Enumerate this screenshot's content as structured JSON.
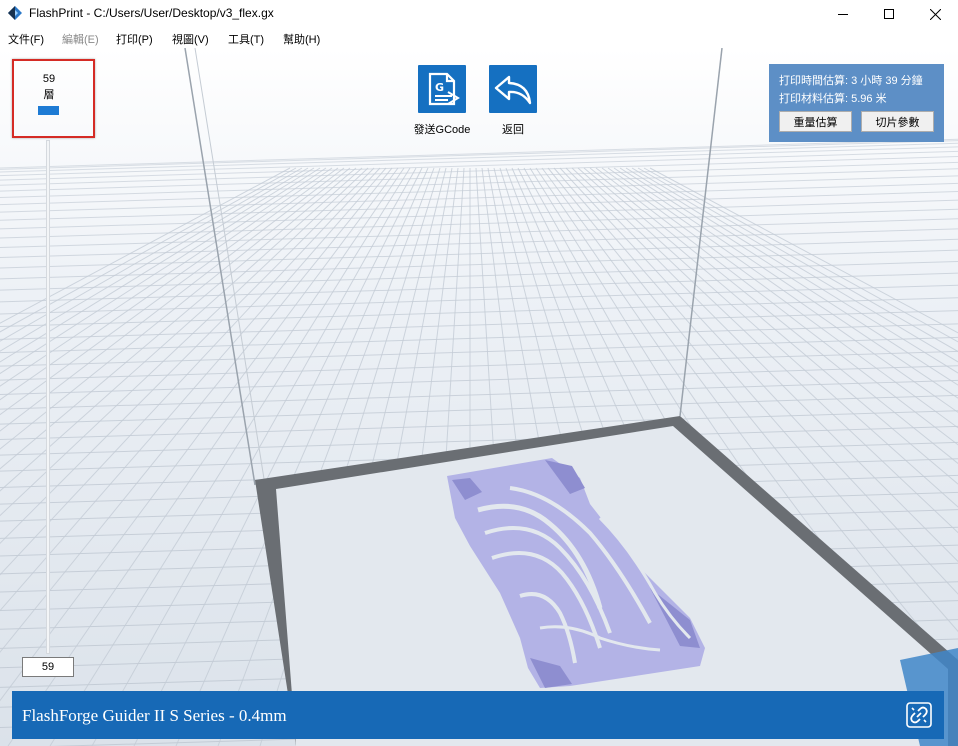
{
  "window": {
    "title": "FlashPrint - C:/Users/User/Desktop/v3_flex.gx"
  },
  "menu": [
    {
      "label": "文件(F)",
      "enabled": true
    },
    {
      "label": "編輯(E)",
      "enabled": false
    },
    {
      "label": "打印(P)",
      "enabled": true
    },
    {
      "label": "視圖(V)",
      "enabled": true
    },
    {
      "label": "工具(T)",
      "enabled": true
    },
    {
      "label": "幫助(H)",
      "enabled": true
    }
  ],
  "layer_panel": {
    "current_layer": "59",
    "unit": "層",
    "input_value": "59"
  },
  "toolbar": {
    "send_gcode_label": "發送GCode",
    "back_label": "返回"
  },
  "info_panel": {
    "print_time_label": "打印時間估算:",
    "print_time_value": "3 小時 39 分鐘",
    "material_label": "打印材料估算:",
    "material_value": "5.96 米",
    "weight_button": "重量估算",
    "slice_params_button": "切片參數"
  },
  "status_bar": {
    "printer": "FlashForge Guider II S Series - 0.4mm"
  },
  "colors": {
    "accent_blue": "#1570c1",
    "status_blue": "#1769b6",
    "info_panel_blue": "#5d8fc6",
    "model_lavender": "#b3b3e6",
    "highlight_red": "#d52b25"
  },
  "icons": {
    "app": "flashprint-logo-icon",
    "send_gcode": "gcode-file-icon",
    "back": "undo-arrow-icon",
    "link": "link-icon"
  }
}
